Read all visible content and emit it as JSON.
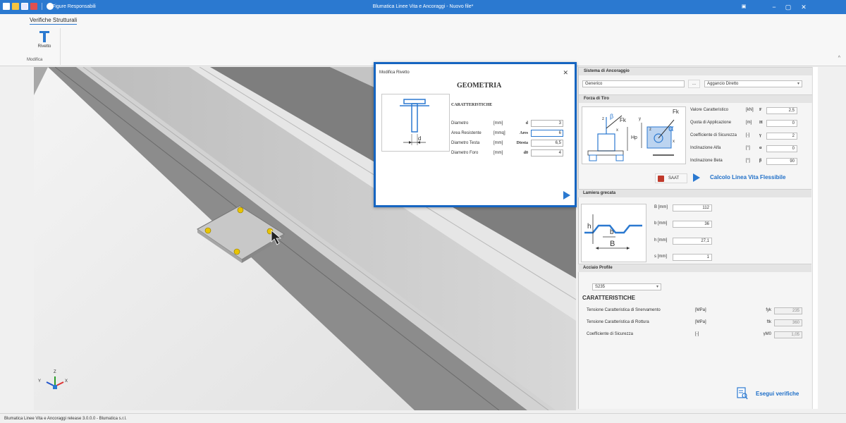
{
  "titlebar": {
    "qat_label": "Figure Responsabili",
    "app_title": "Blumatica Linee Vita e Ancoraggi - Nuovo file*"
  },
  "ribbon": {
    "tab": "Verifiche Strutturali",
    "rivet_button": "Rivetto",
    "group": "Modifica"
  },
  "dialog": {
    "title": "Modifica Rivetto",
    "heading": "GEOMETRIA",
    "section": "CARATTERISTICHE",
    "diagram_label": "d",
    "params": [
      {
        "name": "Diametro",
        "unit": "[mm]",
        "symbol": "d",
        "value": "3"
      },
      {
        "name": "Area Resistente",
        "unit": "[mmq]",
        "symbol": "Ares",
        "value": "6"
      },
      {
        "name": "Diametro Testa",
        "unit": "[mm]",
        "symbol": "Dtesta",
        "value": "6,5"
      },
      {
        "name": "Diametro Foro",
        "unit": "[mm]",
        "symbol": "d0",
        "value": "4"
      }
    ]
  },
  "ancoraggio": {
    "header": "Sistema di Ancoraggio",
    "system": "Generico",
    "dots": "...",
    "mode": "Aggancio Diretto"
  },
  "forza": {
    "header": "Forza di Tiro",
    "img_labels": {
      "beta": "β",
      "fk1": "Fk",
      "z": "z",
      "x": "x",
      "hp": "Hp",
      "fk2": "Fk",
      "y": "y",
      "alpha": "α",
      "z2": "z",
      "x2": "x"
    },
    "rows": [
      {
        "name": "Valore Caratteristico",
        "unit": "[kN]",
        "symbol": "F",
        "value": "2,5"
      },
      {
        "name": "Quota di Applicazione",
        "unit": "[m]",
        "symbol": "H",
        "value": "0"
      },
      {
        "name": "Coefficiente di Sicurezza",
        "unit": "[-]",
        "symbol": "γ",
        "value": "2"
      },
      {
        "name": "Inclinazione Alfa",
        "unit": "[°]",
        "symbol": "α",
        "value": "0"
      },
      {
        "name": "Inclinazione Beta",
        "unit": "[°]",
        "symbol": "β",
        "value": "90"
      }
    ],
    "saat_label": "SAAT",
    "calc_label": "Calcolo Linea Vita Flessibile"
  },
  "lamiera": {
    "header": "Lamiera grecata",
    "img_labels": {
      "h": "h",
      "b": "b",
      "B": "B"
    },
    "rows": [
      {
        "label": "B [mm]",
        "value": "112"
      },
      {
        "label": "b [mm]",
        "value": "36"
      },
      {
        "label": "h [mm]",
        "value": "27,1"
      },
      {
        "label": "s [mm]",
        "value": "1"
      }
    ]
  },
  "acciaio": {
    "header": "Acciaio Profile",
    "material": "S235",
    "section": "CARATTERISTICHE",
    "rows": [
      {
        "name": "Tensione Caratteristica di Snervamento",
        "unit": "[MPa]",
        "symbol": "fyk",
        "value": "235"
      },
      {
        "name": "Tensione Caratteristica di Rottura",
        "unit": "[MPa]",
        "symbol": "ftk",
        "value": "360"
      },
      {
        "name": "Coefficiente di Sicurezza",
        "unit": "[-]",
        "symbol": "γM0",
        "value": "1,05"
      }
    ]
  },
  "axes": {
    "y": "Y",
    "z": "Z",
    "x": "X"
  },
  "esegui_label": "Esegui verifiche",
  "status": "Blumatica Linee Vita e Ancoraggi release 3.0.0.0 - Blumatica s.r.l.",
  "colors": {
    "accent": "#2b79d0",
    "highlight": "#1665c1",
    "rivet": "#e8c400"
  }
}
